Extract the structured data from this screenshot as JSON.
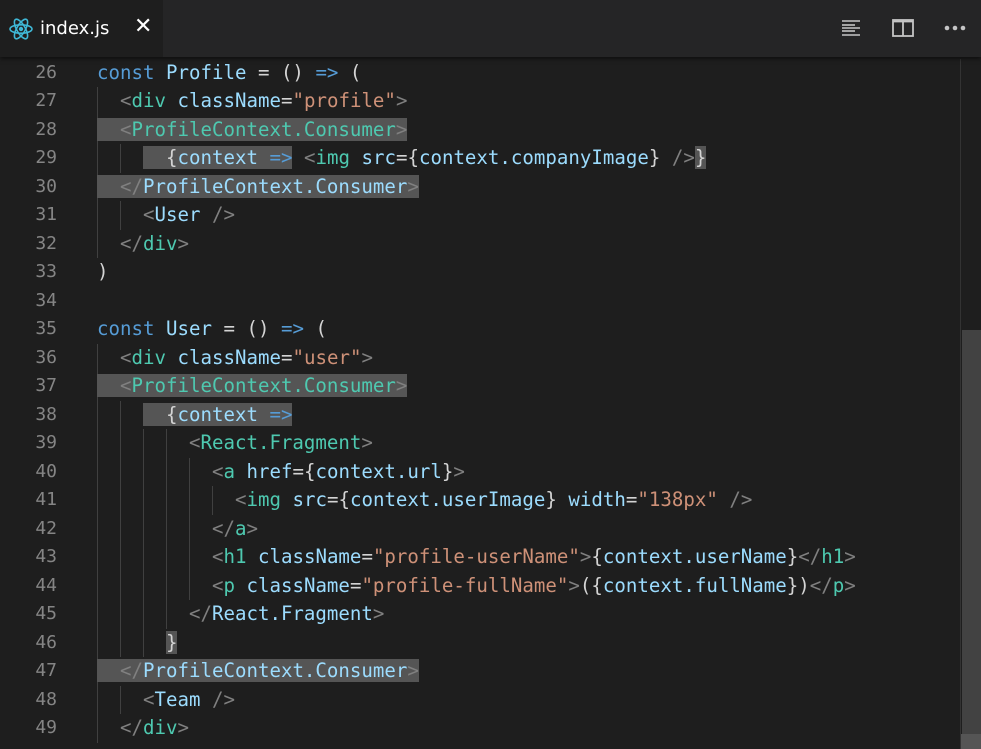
{
  "tab": {
    "filename": "index.js",
    "close_label": "✕",
    "icon": "react-icon"
  },
  "actions": [
    "toggle-minimap-icon",
    "split-editor-icon",
    "more-actions-icon"
  ],
  "colors": {
    "keyword": "#569cd6",
    "tag": "#4ec9b0",
    "attr": "#9cdcfe",
    "string": "#ce9178",
    "punct": "#808080",
    "text": "#d4d4d4",
    "highlight": "#555555"
  },
  "lines": [
    {
      "n": "26",
      "tokens": [
        [
          "k",
          "const"
        ],
        [
          "w",
          " "
        ],
        [
          "v",
          "Profile"
        ],
        [
          "w",
          " = () "
        ],
        [
          "k",
          "=>"
        ],
        [
          "w",
          " ("
        ]
      ]
    },
    {
      "n": "27",
      "tokens": [
        [
          "w",
          "  "
        ],
        [
          "p",
          "<"
        ],
        [
          "t",
          "div"
        ],
        [
          "w",
          " "
        ],
        [
          "a",
          "className"
        ],
        [
          "w",
          "="
        ],
        [
          "s",
          "\"profile\""
        ],
        [
          "p",
          ">"
        ]
      ]
    },
    {
      "n": "28",
      "tokens": [
        [
          "w",
          "  ",
          1
        ],
        [
          "p",
          "<",
          1
        ],
        [
          "t",
          "ProfileContext.Consumer",
          1
        ],
        [
          "p",
          ">",
          1
        ]
      ]
    },
    {
      "n": "29",
      "tokens": [
        [
          "w",
          "    "
        ],
        [
          "w",
          "  {",
          1
        ],
        [
          "v",
          "context",
          1
        ],
        [
          "w",
          " ",
          1
        ],
        [
          "k",
          "=>",
          1
        ],
        [
          "w",
          " "
        ],
        [
          "p",
          "<"
        ],
        [
          "t",
          "img"
        ],
        [
          "w",
          " "
        ],
        [
          "a",
          "src"
        ],
        [
          "w",
          "={"
        ],
        [
          "v",
          "context.companyImage"
        ],
        [
          "w",
          "} "
        ],
        [
          "p",
          "/>"
        ],
        [
          "w",
          "}",
          1
        ]
      ]
    },
    {
      "n": "30",
      "tokens": [
        [
          "w",
          "  ",
          1
        ],
        [
          "p",
          "</",
          1
        ],
        [
          "a",
          "ProfileContext.Consumer",
          1
        ],
        [
          "p",
          ">",
          1
        ]
      ]
    },
    {
      "n": "31",
      "tokens": [
        [
          "w",
          "    "
        ],
        [
          "p",
          "<"
        ],
        [
          "v",
          "User"
        ],
        [
          "w",
          " "
        ],
        [
          "p",
          "/>"
        ]
      ]
    },
    {
      "n": "32",
      "tokens": [
        [
          "w",
          "  "
        ],
        [
          "p",
          "</"
        ],
        [
          "t",
          "div"
        ],
        [
          "p",
          ">"
        ]
      ]
    },
    {
      "n": "33",
      "tokens": [
        [
          "w",
          ")"
        ]
      ]
    },
    {
      "n": "34",
      "tokens": []
    },
    {
      "n": "35",
      "tokens": [
        [
          "k",
          "const"
        ],
        [
          "w",
          " "
        ],
        [
          "v",
          "User"
        ],
        [
          "w",
          " = () "
        ],
        [
          "k",
          "=>"
        ],
        [
          "w",
          " ("
        ]
      ]
    },
    {
      "n": "36",
      "tokens": [
        [
          "w",
          "  "
        ],
        [
          "p",
          "<"
        ],
        [
          "t",
          "div"
        ],
        [
          "w",
          " "
        ],
        [
          "a",
          "className"
        ],
        [
          "w",
          "="
        ],
        [
          "s",
          "\"user\""
        ],
        [
          "p",
          ">"
        ]
      ]
    },
    {
      "n": "37",
      "tokens": [
        [
          "w",
          "  ",
          1
        ],
        [
          "p",
          "<",
          1
        ],
        [
          "t",
          "ProfileContext.Consumer",
          1
        ],
        [
          "p",
          ">",
          1
        ]
      ]
    },
    {
      "n": "38",
      "tokens": [
        [
          "w",
          "    "
        ],
        [
          "w",
          "  {",
          1
        ],
        [
          "v",
          "context",
          1
        ],
        [
          "w",
          " ",
          1
        ],
        [
          "k",
          "=>",
          1
        ]
      ]
    },
    {
      "n": "39",
      "tokens": [
        [
          "w",
          "        "
        ],
        [
          "p",
          "<"
        ],
        [
          "t",
          "React.Fragment"
        ],
        [
          "p",
          ">"
        ]
      ]
    },
    {
      "n": "40",
      "tokens": [
        [
          "w",
          "          "
        ],
        [
          "p",
          "<"
        ],
        [
          "t",
          "a"
        ],
        [
          "w",
          " "
        ],
        [
          "a",
          "href"
        ],
        [
          "w",
          "={"
        ],
        [
          "v",
          "context.url"
        ],
        [
          "w",
          "}"
        ],
        [
          "p",
          ">"
        ]
      ]
    },
    {
      "n": "41",
      "tokens": [
        [
          "w",
          "            "
        ],
        [
          "p",
          "<"
        ],
        [
          "t",
          "img"
        ],
        [
          "w",
          " "
        ],
        [
          "a",
          "src"
        ],
        [
          "w",
          "={"
        ],
        [
          "v",
          "context.userImage"
        ],
        [
          "w",
          "} "
        ],
        [
          "a",
          "width"
        ],
        [
          "w",
          "="
        ],
        [
          "s",
          "\"138px\""
        ],
        [
          "w",
          " "
        ],
        [
          "p",
          "/>"
        ]
      ]
    },
    {
      "n": "42",
      "tokens": [
        [
          "w",
          "          "
        ],
        [
          "p",
          "</"
        ],
        [
          "t",
          "a"
        ],
        [
          "p",
          ">"
        ]
      ]
    },
    {
      "n": "43",
      "tokens": [
        [
          "w",
          "          "
        ],
        [
          "p",
          "<"
        ],
        [
          "t",
          "h1"
        ],
        [
          "w",
          " "
        ],
        [
          "a",
          "className"
        ],
        [
          "w",
          "="
        ],
        [
          "s",
          "\"profile-userName\""
        ],
        [
          "p",
          ">"
        ],
        [
          "w",
          "{"
        ],
        [
          "v",
          "context.userName"
        ],
        [
          "w",
          "}"
        ],
        [
          "p",
          "</"
        ],
        [
          "t",
          "h1"
        ],
        [
          "p",
          ">"
        ]
      ]
    },
    {
      "n": "44",
      "tokens": [
        [
          "w",
          "          "
        ],
        [
          "p",
          "<"
        ],
        [
          "t",
          "p"
        ],
        [
          "w",
          " "
        ],
        [
          "a",
          "className"
        ],
        [
          "w",
          "="
        ],
        [
          "s",
          "\"profile-fullName\""
        ],
        [
          "p",
          ">"
        ],
        [
          "w",
          "({"
        ],
        [
          "v",
          "context.fullName"
        ],
        [
          "w",
          "})"
        ],
        [
          "p",
          "</"
        ],
        [
          "t",
          "p"
        ],
        [
          "p",
          ">"
        ]
      ]
    },
    {
      "n": "45",
      "tokens": [
        [
          "w",
          "        "
        ],
        [
          "p",
          "</"
        ],
        [
          "a",
          "React.Fragment"
        ],
        [
          "p",
          ">"
        ]
      ]
    },
    {
      "n": "46",
      "tokens": [
        [
          "w",
          "      "
        ],
        [
          "w",
          "}",
          1
        ]
      ]
    },
    {
      "n": "47",
      "tokens": [
        [
          "w",
          "  ",
          1
        ],
        [
          "p",
          "</",
          1
        ],
        [
          "a",
          "ProfileContext.Consumer",
          1
        ],
        [
          "p",
          ">",
          1
        ]
      ]
    },
    {
      "n": "48",
      "tokens": [
        [
          "w",
          "    "
        ],
        [
          "p",
          "<"
        ],
        [
          "v",
          "Team"
        ],
        [
          "w",
          " "
        ],
        [
          "p",
          "/>"
        ]
      ]
    },
    {
      "n": "49",
      "tokens": [
        [
          "w",
          "  "
        ],
        [
          "p",
          "</"
        ],
        [
          "t",
          "div"
        ],
        [
          "p",
          ">"
        ]
      ]
    }
  ]
}
